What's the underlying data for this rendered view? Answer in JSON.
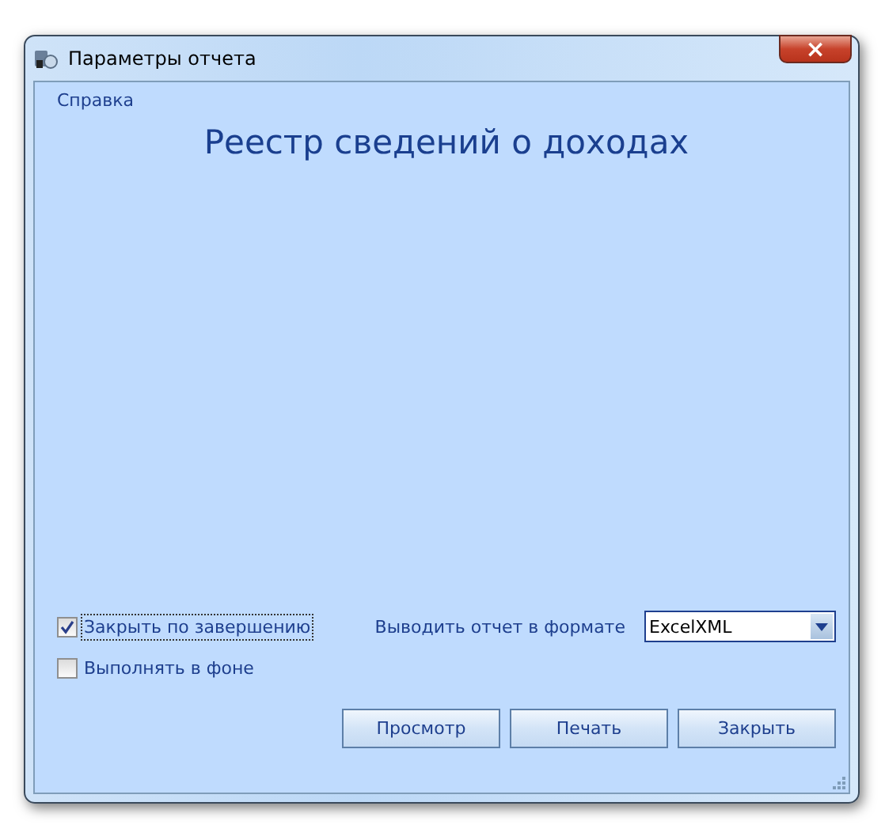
{
  "window": {
    "title": "Параметры отчета",
    "close": "×"
  },
  "help_link": "Справка",
  "heading": "Реестр сведений о доходах",
  "options": [
    {
      "label": "Закрыть по завершению",
      "checked": true,
      "focused": true
    },
    {
      "label": "Выполнять в фоне",
      "checked": false,
      "focused": false
    }
  ],
  "format": {
    "label": "Выводить отчет в формате",
    "value": "ExcelXML"
  },
  "buttons": [
    "Просмотр",
    "Печать",
    "Закрыть"
  ]
}
